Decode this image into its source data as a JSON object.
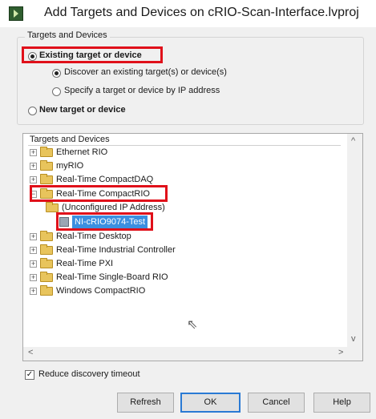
{
  "window": {
    "title": "Add Targets and Devices on cRIO-Scan-Interface.lvproj",
    "icon": "labview-app-icon"
  },
  "target_group": {
    "legend": "Targets and Devices",
    "existing_label": "Existing target or device",
    "discover_label": "Discover an existing target(s) or device(s)",
    "specify_label": "Specify a target or device by IP address",
    "new_label": "New target or device"
  },
  "tree": {
    "header": "Targets and Devices",
    "items": [
      {
        "label": "Ethernet RIO"
      },
      {
        "label": "myRIO"
      },
      {
        "label": "Real-Time CompactDAQ"
      },
      {
        "label": "Real-Time CompactRIO"
      },
      {
        "label": "(Unconfigured IP Address)"
      },
      {
        "label": "NI-cRIO9074-Test"
      },
      {
        "label": "Real-Time Desktop"
      },
      {
        "label": "Real-Time Industrial Controller"
      },
      {
        "label": "Real-Time PXI"
      },
      {
        "label": "Real-Time Single-Board RIO"
      },
      {
        "label": "Windows CompactRIO"
      }
    ],
    "expander_collapsed": "+",
    "expander_expanded": "−"
  },
  "scroll": {
    "up": "^",
    "down": "v",
    "left": "<",
    "right": ">"
  },
  "reduce_timeout": {
    "label": "Reduce discovery timeout",
    "checked": "✓"
  },
  "buttons": {
    "refresh": "Refresh",
    "ok": "OK",
    "cancel": "Cancel",
    "help": "Help"
  },
  "colors": {
    "highlight": "#e0101a",
    "selection": "#3b8fe0"
  }
}
